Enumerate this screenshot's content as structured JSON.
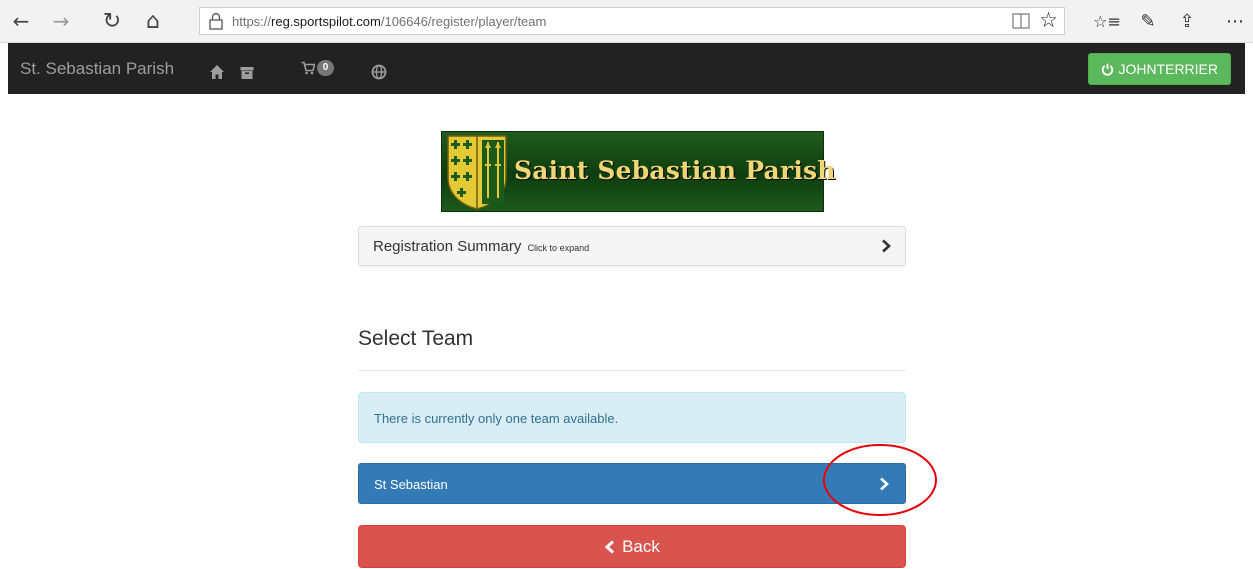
{
  "browser": {
    "url_prefix": "https://",
    "url_host": "reg.sportspilot.com",
    "url_path": "/106646/register/player/team",
    "icons": [
      "back-arrow-icon",
      "forward-arrow-icon",
      "refresh-icon",
      "home-icon",
      "lock-icon",
      "reading-view-icon",
      "favorite-star-icon",
      "favorites-list-icon",
      "pen-icon",
      "share-icon",
      "more-icon"
    ],
    "glyphs": {
      "back": "←",
      "forward": "→",
      "refresh": "↻",
      "home": "⌂",
      "star": "☆",
      "favorites": "☆≡",
      "pen": "✎",
      "share": "⇪",
      "more": "⋯"
    }
  },
  "navbar": {
    "brand": "St. Sebastian Parish",
    "cart_count": "0",
    "user_button": "JOHNTERRIER",
    "icons": [
      "home-icon",
      "archive-icon",
      "cart-icon",
      "globe-icon",
      "power-icon"
    ]
  },
  "logo": {
    "text": "Saint Sebastian Parish"
  },
  "summary": {
    "title": "Registration Summary",
    "hint": "Click to expand"
  },
  "select_team": {
    "heading": "Select Team",
    "alert": "There is currently only one team available.",
    "team_name": "St Sebastian",
    "back_label": "Back"
  },
  "colors": {
    "navbar_bg": "#222222",
    "user_button": "#5cb85c",
    "team_button": "#337ab7",
    "back_button": "#d9534f",
    "alert_bg": "#d9edf7",
    "annotation": "#e8000b"
  }
}
